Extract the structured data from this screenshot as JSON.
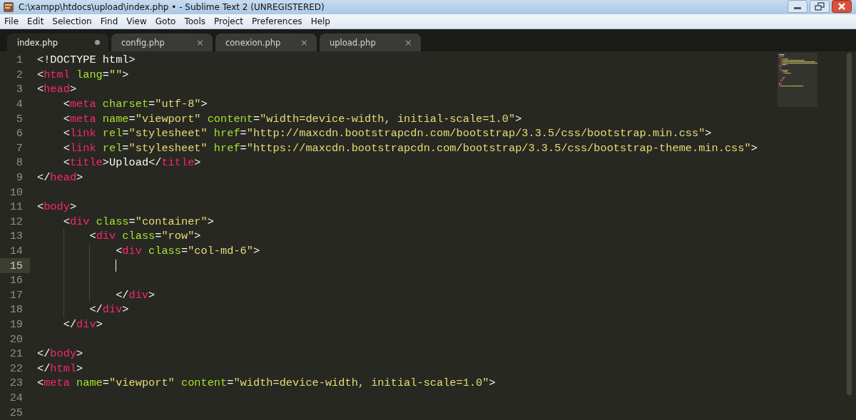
{
  "window": {
    "title": "C:\\xampp\\htdocs\\upload\\index.php • - Sublime Text 2 (UNREGISTERED)"
  },
  "menu": [
    "File",
    "Edit",
    "Selection",
    "Find",
    "View",
    "Goto",
    "Tools",
    "Project",
    "Preferences",
    "Help"
  ],
  "tabs": [
    {
      "label": "index.php",
      "selected": true,
      "modified": true
    },
    {
      "label": "config.php",
      "selected": false,
      "modified": false,
      "close": "×"
    },
    {
      "label": "conexion.php",
      "selected": false,
      "modified": false,
      "close": "×"
    },
    {
      "label": "upload.php",
      "selected": false,
      "modified": false,
      "close": "×"
    }
  ],
  "editor": {
    "lines": [
      {
        "number": "1",
        "current": false,
        "tokens": [
          {
            "kind": "punct",
            "text": "<!DOCTYPE html>"
          }
        ]
      },
      {
        "number": "2",
        "current": false,
        "tokens": [
          {
            "kind": "punct",
            "text": "<"
          },
          {
            "kind": "tag",
            "text": "html"
          },
          {
            "kind": "attr",
            "text": " lang"
          },
          {
            "kind": "punct",
            "text": "="
          },
          {
            "kind": "str",
            "text": "\"\""
          },
          {
            "kind": "punct",
            "text": ">"
          }
        ]
      },
      {
        "number": "3",
        "current": false,
        "tokens": [
          {
            "kind": "punct",
            "text": "<"
          },
          {
            "kind": "tag",
            "text": "head"
          },
          {
            "kind": "punct",
            "text": ">"
          }
        ]
      },
      {
        "number": "4",
        "current": false,
        "tokens": [
          {
            "kind": "punct",
            "text": "    <"
          },
          {
            "kind": "tag",
            "text": "meta"
          },
          {
            "kind": "attr",
            "text": " charset"
          },
          {
            "kind": "punct",
            "text": "="
          },
          {
            "kind": "str",
            "text": "\"utf-8\""
          },
          {
            "kind": "punct",
            "text": ">"
          }
        ]
      },
      {
        "number": "5",
        "current": false,
        "tokens": [
          {
            "kind": "punct",
            "text": "    <"
          },
          {
            "kind": "tag",
            "text": "meta"
          },
          {
            "kind": "attr",
            "text": " name"
          },
          {
            "kind": "punct",
            "text": "="
          },
          {
            "kind": "str",
            "text": "\"viewport\""
          },
          {
            "kind": "attr",
            "text": " content"
          },
          {
            "kind": "punct",
            "text": "="
          },
          {
            "kind": "str",
            "text": "\"width=device-width, initial-scale=1.0\""
          },
          {
            "kind": "punct",
            "text": ">"
          }
        ]
      },
      {
        "number": "6",
        "current": false,
        "tokens": [
          {
            "kind": "punct",
            "text": "    <"
          },
          {
            "kind": "tag",
            "text": "link"
          },
          {
            "kind": "attr",
            "text": " rel"
          },
          {
            "kind": "punct",
            "text": "="
          },
          {
            "kind": "str",
            "text": "\"stylesheet\""
          },
          {
            "kind": "attr",
            "text": " href"
          },
          {
            "kind": "punct",
            "text": "="
          },
          {
            "kind": "str",
            "text": "\"http://maxcdn.bootstrapcdn.com/bootstrap/3.3.5/css/bootstrap.min.css\""
          },
          {
            "kind": "punct",
            "text": ">"
          }
        ]
      },
      {
        "number": "7",
        "current": false,
        "tokens": [
          {
            "kind": "punct",
            "text": "    <"
          },
          {
            "kind": "tag",
            "text": "link"
          },
          {
            "kind": "attr",
            "text": " rel"
          },
          {
            "kind": "punct",
            "text": "="
          },
          {
            "kind": "str",
            "text": "\"stylesheet\""
          },
          {
            "kind": "attr",
            "text": " href"
          },
          {
            "kind": "punct",
            "text": "="
          },
          {
            "kind": "str",
            "text": "\"https://maxcdn.bootstrapcdn.com/bootstrap/3.3.5/css/bootstrap-theme.min.css\""
          },
          {
            "kind": "punct",
            "text": ">"
          }
        ]
      },
      {
        "number": "8",
        "current": false,
        "tokens": [
          {
            "kind": "punct",
            "text": "    <"
          },
          {
            "kind": "tag",
            "text": "title"
          },
          {
            "kind": "punct",
            "text": ">Upload</"
          },
          {
            "kind": "tag",
            "text": "title"
          },
          {
            "kind": "punct",
            "text": ">"
          }
        ]
      },
      {
        "number": "9",
        "current": false,
        "tokens": [
          {
            "kind": "punct",
            "text": "</"
          },
          {
            "kind": "tag",
            "text": "head"
          },
          {
            "kind": "punct",
            "text": ">"
          }
        ]
      },
      {
        "number": "10",
        "current": false
      },
      {
        "number": "11",
        "current": false,
        "tokens": [
          {
            "kind": "punct",
            "text": "<"
          },
          {
            "kind": "tag",
            "text": "body"
          },
          {
            "kind": "punct",
            "text": ">"
          }
        ]
      },
      {
        "number": "12",
        "current": false,
        "tokens": [
          {
            "kind": "punct",
            "text": "    <"
          },
          {
            "kind": "tag",
            "text": "div"
          },
          {
            "kind": "attr",
            "text": " class"
          },
          {
            "kind": "punct",
            "text": "="
          },
          {
            "kind": "str",
            "text": "\"container\""
          },
          {
            "kind": "punct",
            "text": ">"
          }
        ]
      },
      {
        "number": "13",
        "current": false,
        "tokens": [
          {
            "kind": "punct",
            "text": "        <"
          },
          {
            "kind": "tag",
            "text": "div"
          },
          {
            "kind": "attr",
            "text": " class"
          },
          {
            "kind": "punct",
            "text": "="
          },
          {
            "kind": "str",
            "text": "\"row\""
          },
          {
            "kind": "punct",
            "text": ">"
          }
        ]
      },
      {
        "number": "14",
        "current": false,
        "tokens": [
          {
            "kind": "punct",
            "text": "            <"
          },
          {
            "kind": "tag",
            "text": "div"
          },
          {
            "kind": "attr",
            "text": " class"
          },
          {
            "kind": "punct",
            "text": "="
          },
          {
            "kind": "str",
            "text": "\"col-md-6\""
          },
          {
            "kind": "punct",
            "text": ">"
          }
        ]
      },
      {
        "number": "15",
        "current": true
      },
      {
        "number": "16",
        "current": false
      },
      {
        "number": "17",
        "current": false,
        "tokens": [
          {
            "kind": "punct",
            "text": "            </"
          },
          {
            "kind": "tag",
            "text": "div"
          },
          {
            "kind": "punct",
            "text": ">"
          }
        ]
      },
      {
        "number": "18",
        "current": false,
        "tokens": [
          {
            "kind": "punct",
            "text": "        </"
          },
          {
            "kind": "tag",
            "text": "div"
          },
          {
            "kind": "punct",
            "text": ">"
          }
        ]
      },
      {
        "number": "19",
        "current": false,
        "tokens": [
          {
            "kind": "punct",
            "text": "    </"
          },
          {
            "kind": "tag",
            "text": "div"
          },
          {
            "kind": "punct",
            "text": ">"
          }
        ]
      },
      {
        "number": "20",
        "current": false
      },
      {
        "number": "21",
        "current": false,
        "tokens": [
          {
            "kind": "punct",
            "text": "</"
          },
          {
            "kind": "tag",
            "text": "body"
          },
          {
            "kind": "punct",
            "text": ">"
          }
        ]
      },
      {
        "number": "22",
        "current": false,
        "tokens": [
          {
            "kind": "punct",
            "text": "</"
          },
          {
            "kind": "tag",
            "text": "html"
          },
          {
            "kind": "punct",
            "text": ">"
          }
        ]
      },
      {
        "number": "23",
        "current": false,
        "tokens": [
          {
            "kind": "punct",
            "text": "<"
          },
          {
            "kind": "tag",
            "text": "meta"
          },
          {
            "kind": "attr",
            "text": " name"
          },
          {
            "kind": "punct",
            "text": "="
          },
          {
            "kind": "str",
            "text": "\"viewport\""
          },
          {
            "kind": "attr",
            "text": " content"
          },
          {
            "kind": "punct",
            "text": "="
          },
          {
            "kind": "str",
            "text": "\"width=device-width, initial-scale=1.0\""
          },
          {
            "kind": "punct",
            "text": ">"
          }
        ]
      },
      {
        "number": "24",
        "current": false
      },
      {
        "number": "25",
        "current": false
      }
    ]
  }
}
